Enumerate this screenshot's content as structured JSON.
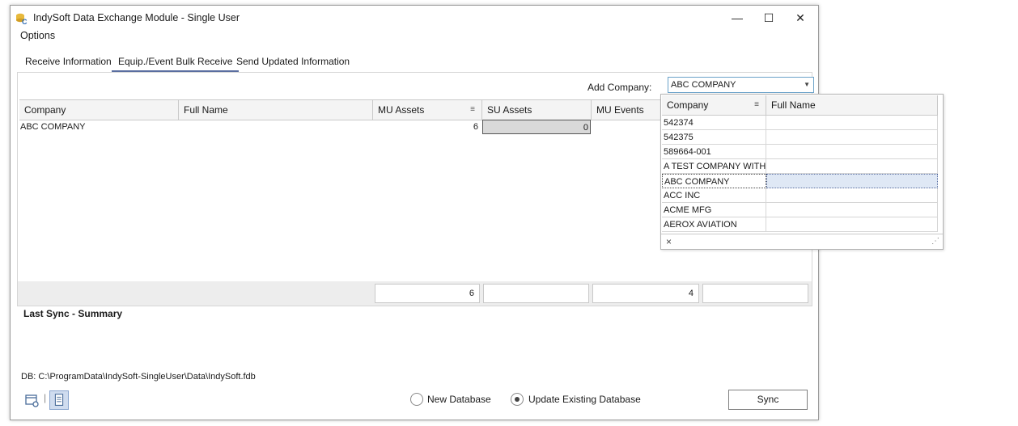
{
  "window": {
    "title": "IndySoft Data Exchange Module - Single User",
    "minimize_glyph": "—",
    "maximize_glyph": "☐",
    "close_glyph": "✕"
  },
  "menu": {
    "options": "Options"
  },
  "tabs": [
    {
      "label": "Receive Information",
      "active": false
    },
    {
      "label": "Equip./Event Bulk Receive",
      "active": true
    },
    {
      "label": "Send Updated Information",
      "active": false
    }
  ],
  "add_company": {
    "label": "Add Company:",
    "value": "ABC COMPANY"
  },
  "grid": {
    "columns": [
      "Company",
      "Full Name",
      "MU Assets",
      "SU Assets",
      "MU Events"
    ],
    "rows": [
      {
        "company": "ABC COMPANY",
        "full_name": "",
        "mu_assets": "6",
        "su_assets": "0",
        "mu_events": ""
      }
    ],
    "totals": {
      "mu_assets": "6",
      "su_assets": "",
      "mu_events": "4",
      "su_events": ""
    }
  },
  "summary_title": "Last Sync - Summary",
  "db_path": "DB: C:\\ProgramData\\IndySoft-SingleUser\\Data\\IndySoft.fdb",
  "radios": {
    "new_database": {
      "label": "New Database",
      "checked": false
    },
    "update_existing": {
      "label": "Update Existing Database",
      "checked": true
    }
  },
  "sync_button": "Sync",
  "dropdown": {
    "columns": [
      "Company",
      "Full Name"
    ],
    "rows": [
      {
        "company": "542374",
        "full_name": ""
      },
      {
        "company": "542375",
        "full_name": ""
      },
      {
        "company": "589664-001",
        "full_name": ""
      },
      {
        "company": "A TEST COMPANY WITH I",
        "full_name": ""
      },
      {
        "company": "ABC COMPANY",
        "full_name": "",
        "selected": true
      },
      {
        "company": "ACC INC",
        "full_name": ""
      },
      {
        "company": "ACME MFG",
        "full_name": ""
      },
      {
        "company": "AEROX AVIATION",
        "full_name": ""
      }
    ],
    "clear_glyph": "×",
    "grip_glyph": "⋰"
  },
  "colors": {
    "accent": "#5a6ea0",
    "focus_border": "#6aa2c9",
    "selection": "#dfe8f5"
  }
}
